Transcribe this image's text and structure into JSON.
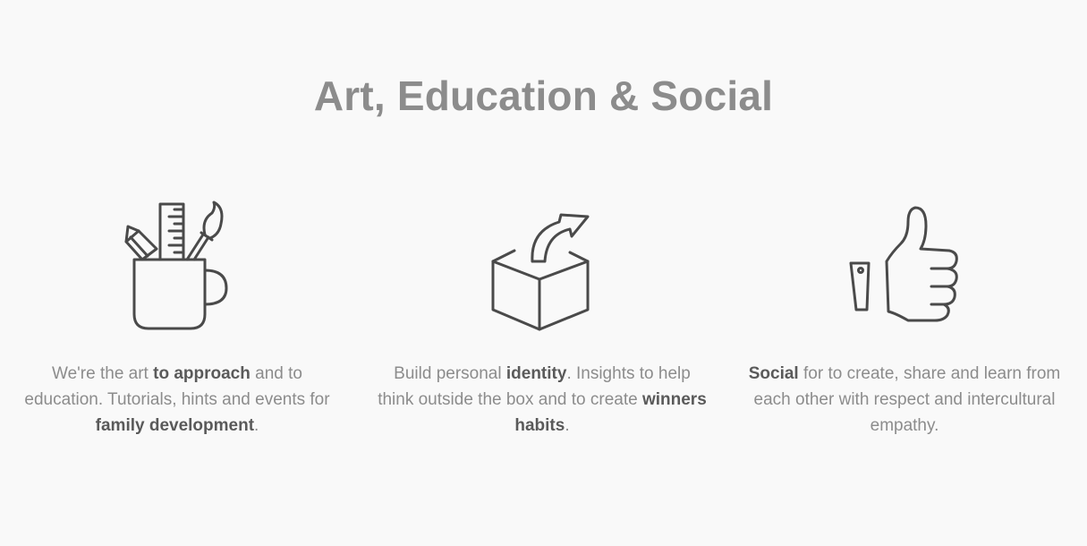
{
  "heading": "Art, Education & Social",
  "features": [
    {
      "icon": "art-supplies-mug-icon",
      "parts": [
        "We're the art ",
        "to approach",
        " and to education. Tutorials, hints and events for ",
        "family development",
        "."
      ]
    },
    {
      "icon": "open-box-arrow-icon",
      "parts": [
        "Build personal ",
        "identity",
        ". Insights to help think outside the box and to create ",
        "winners habits",
        "."
      ]
    },
    {
      "icon": "thumbs-up-icon",
      "parts": [
        "",
        "Social",
        " for to create, share and learn from each other with respect and intercultural empathy."
      ]
    }
  ],
  "colors": {
    "background": "#f9f9f9",
    "heading": "#8c8c8c",
    "body_text": "#8c8c8c",
    "emphasis": "#5a5a5a",
    "icon_stroke": "#4a4a4a"
  }
}
